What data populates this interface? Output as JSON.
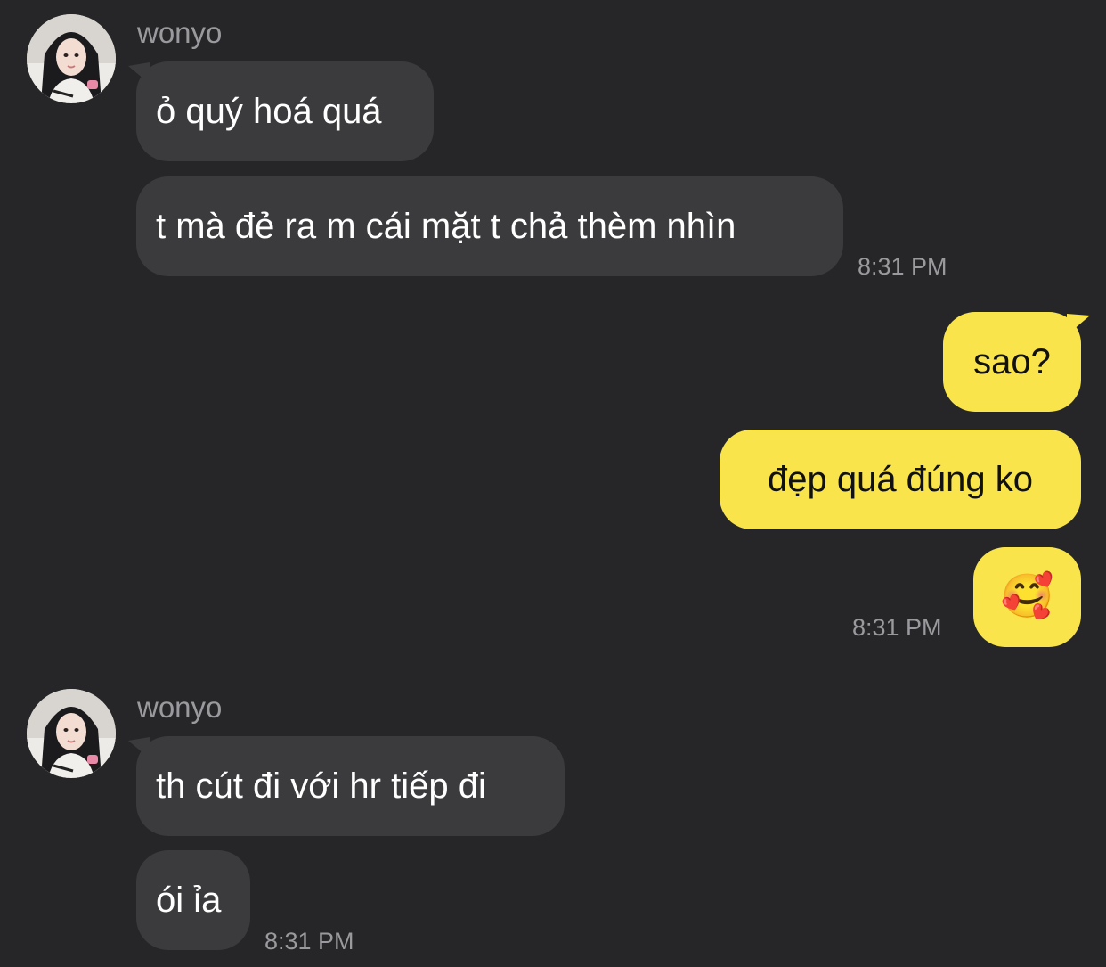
{
  "theme": {
    "background": "#262628",
    "incoming_bubble": "#3b3b3e",
    "outgoing_bubble": "#f9e54b",
    "meta_text": "#9a9a9e"
  },
  "group1": {
    "sender": "wonyo",
    "avatar_icon": "profile-photo-avatar",
    "messages": [
      "ỏ quý hoá quá",
      "t mà đẻ ra m cái mặt t chả thèm nhìn"
    ],
    "time": "8:31 PM"
  },
  "group2": {
    "messages": [
      "sao?",
      "đẹp quá đúng ko",
      "🥰"
    ],
    "time": "8:31 PM"
  },
  "group3": {
    "sender": "wonyo",
    "avatar_icon": "profile-photo-avatar",
    "messages": [
      "th cút đi với hr tiếp đi",
      "ói ỉa"
    ],
    "time": "8:31 PM"
  }
}
